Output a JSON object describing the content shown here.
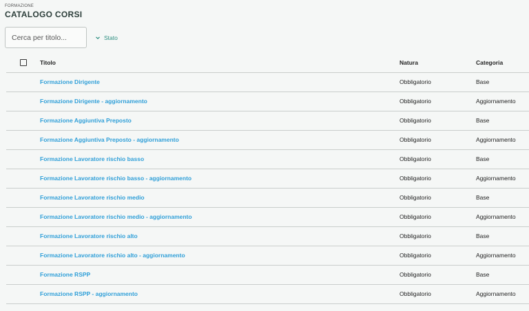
{
  "header": {
    "breadcrumb": "FORMAZIONE",
    "title": "CATALOGO CORSI"
  },
  "toolbar": {
    "search_placeholder": "Cerca per titolo...",
    "filter_label": "Stato"
  },
  "table": {
    "columns": [
      "Titolo",
      "Natura",
      "Categoria"
    ],
    "rows": [
      {
        "titolo": "Formazione Dirigente",
        "natura": "Obbligatorio",
        "categoria": "Base"
      },
      {
        "titolo": "Formazione Dirigente - aggiornamento",
        "natura": "Obbligatorio",
        "categoria": "Aggiornamento"
      },
      {
        "titolo": "Formazione Aggiuntiva Preposto",
        "natura": "Obbligatorio",
        "categoria": "Base"
      },
      {
        "titolo": "Formazione Aggiuntiva Preposto - aggiornamento",
        "natura": "Obbligatorio",
        "categoria": "Aggiornamento"
      },
      {
        "titolo": "Formazione Lavoratore rischio basso",
        "natura": "Obbligatorio",
        "categoria": "Base"
      },
      {
        "titolo": "Formazione Lavoratore rischio basso - aggiornamento",
        "natura": "Obbligatorio",
        "categoria": "Aggiornamento"
      },
      {
        "titolo": "Formazione Lavoratore rischio medio",
        "natura": "Obbligatorio",
        "categoria": "Base"
      },
      {
        "titolo": "Formazione Lavoratore rischio medio - aggiornamento",
        "natura": "Obbligatorio",
        "categoria": "Aggiornamento"
      },
      {
        "titolo": "Formazione Lavoratore rischio alto",
        "natura": "Obbligatorio",
        "categoria": "Base"
      },
      {
        "titolo": "Formazione Lavoratore rischio alto - aggiornamento",
        "natura": "Obbligatorio",
        "categoria": "Aggiornamento"
      },
      {
        "titolo": "Formazione RSPP",
        "natura": "Obbligatorio",
        "categoria": "Base"
      },
      {
        "titolo": "Formazione RSPP - aggiornamento",
        "natura": "Obbligatorio",
        "categoria": "Aggiornamento"
      }
    ]
  },
  "colors": {
    "link": "#2f9fd8",
    "accent": "#2a8d7f",
    "title": "#2c3e3a"
  },
  "icons": {
    "filter_chevron": "chevron-down-icon",
    "select_all": "checkbox-icon"
  }
}
